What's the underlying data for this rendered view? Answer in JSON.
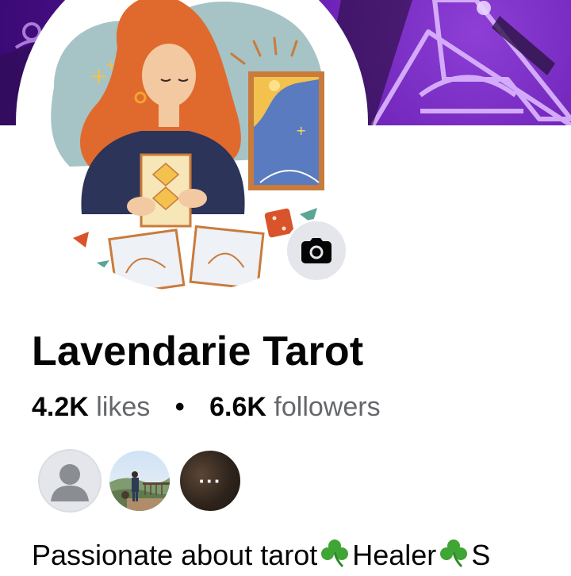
{
  "cover": {
    "background": "#4d1190",
    "accent": "#ddb8ff"
  },
  "profile": {
    "name": "Lavendarie Tarot",
    "likes_count": "4.2K",
    "likes_label": "likes",
    "separator": "•",
    "followers_count": "6.6K",
    "followers_label": "followers",
    "camera_icon": "camera-icon"
  },
  "friends": {
    "more_label": "···"
  },
  "bio": {
    "part1": "Passionate about tarot",
    "part2": "Healer",
    "part3": "S",
    "emoji": "shamrock"
  }
}
